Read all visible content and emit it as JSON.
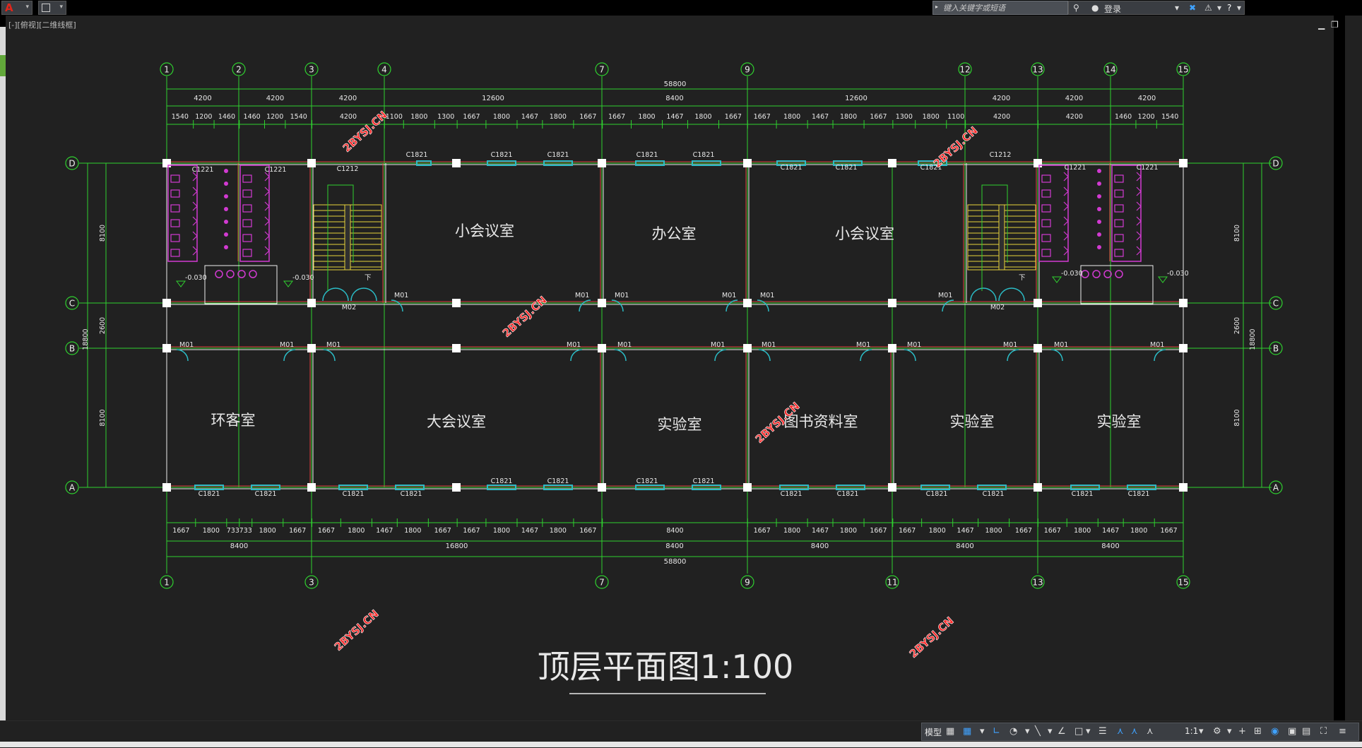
{
  "app": {
    "logo_letter": "A",
    "search_placeholder": "键入关键字或短语",
    "login_label": "登录",
    "viewport_label": "[-][俯视][二维线框]"
  },
  "plan": {
    "title": "顶层平面图1:100",
    "watermark": "2BYSJ.CN",
    "top_grid_labels": [
      "1",
      "2",
      "3",
      "4",
      "7",
      "9",
      "12",
      "13",
      "14",
      "15"
    ],
    "bottom_grid_labels": [
      "1",
      "3",
      "7",
      "9",
      "11",
      "13",
      "15"
    ],
    "row_labels": [
      "D",
      "C",
      "B",
      "A"
    ],
    "top_total_dim": "58800",
    "top_dims_row2": [
      "4200",
      "4200",
      "4200",
      "12600",
      "8400",
      "12600",
      "4200",
      "4200",
      "4200"
    ],
    "top_dims_row3": [
      "1540",
      "1200",
      "1460",
      "1460",
      "1200",
      "1540",
      "4200",
      "1100",
      "1800",
      "1300",
      "1667",
      "1800",
      "1467",
      "1800",
      "1667",
      "1667",
      "1800",
      "1467",
      "1800",
      "1667",
      "1667",
      "1800",
      "1467",
      "1800",
      "1667",
      "1300",
      "1800",
      "1100",
      "4200",
      "4200",
      "1460",
      "1200",
      "1540"
    ],
    "bottom_dims_row1": [
      "1667",
      "1800",
      "733",
      "733",
      "1800",
      "1667",
      "1667",
      "1800",
      "1467",
      "1800",
      "1667",
      "1667",
      "1800",
      "1467",
      "1800",
      "1667",
      "8400",
      "1667",
      "1800",
      "1467",
      "1800",
      "1667",
      "1667",
      "1800",
      "1467",
      "1800",
      "1667",
      "1667",
      "1800",
      "1467",
      "1800",
      "1667"
    ],
    "bottom_dims_row2": [
      "8400",
      "16800",
      "8400",
      "8400",
      "8400",
      "8400"
    ],
    "bottom_total_dim": "58800",
    "side_dims_left": [
      "8100",
      "2600",
      "8100",
      "18800"
    ],
    "side_dims_right": [
      "8100",
      "2600",
      "8100",
      "18800"
    ],
    "rooms": {
      "small_meeting_1": "小会议室",
      "office": "办公室",
      "small_meeting_2": "小会议室",
      "reception": "环客室",
      "large_meeting": "大会议室",
      "lab_1": "实验室",
      "library": "图书资料室",
      "lab_2": "实验室",
      "lab_3": "实验室"
    },
    "window_tag_c1821": "C1821",
    "window_tag_c1221": "C1221",
    "window_tag_c1212": "C1212",
    "door_tag_m01": "M01",
    "door_tag_m02": "M02",
    "level_tag": "-0.030",
    "stair_dir": "下"
  },
  "status": {
    "model_tab": "模型",
    "scale": "1:1"
  },
  "colors": {
    "grid_green": "#2fd12f",
    "wall_red": "#e04040",
    "window_cyan": "#2bbcc6",
    "fixture_magenta": "#d23ad2",
    "stair_yellow": "#e6d23a",
    "watermark_red": "#ff2a2a"
  }
}
